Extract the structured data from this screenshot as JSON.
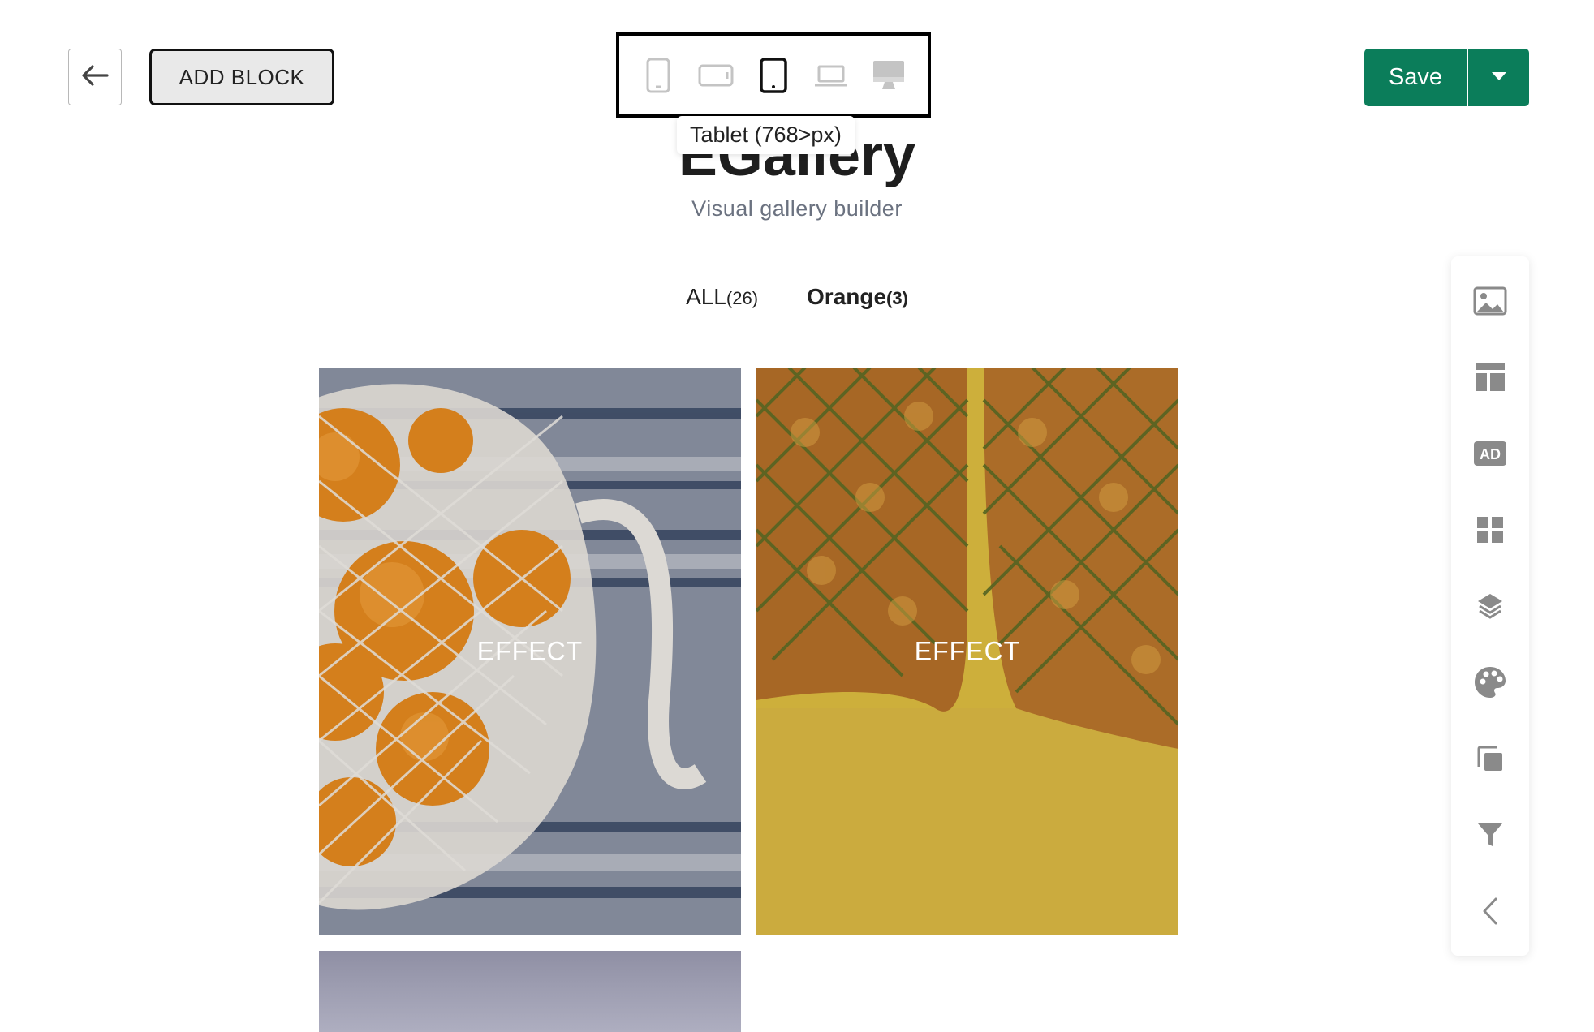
{
  "toolbar": {
    "add_block_label": "ADD BLOCK",
    "save_label": "Save",
    "devices": [
      {
        "name": "mobile",
        "icon": "phone-portrait-icon",
        "active": false
      },
      {
        "name": "mobile-landscape",
        "icon": "phone-landscape-icon",
        "active": false
      },
      {
        "name": "tablet",
        "icon": "tablet-icon",
        "active": true
      },
      {
        "name": "laptop",
        "icon": "laptop-icon",
        "active": false
      },
      {
        "name": "desktop",
        "icon": "desktop-icon",
        "active": false
      }
    ],
    "tooltip": "Tablet (768>px)"
  },
  "header": {
    "title": "EGallery",
    "subtitle": "Visual gallery builder"
  },
  "filters": [
    {
      "label": "ALL",
      "count": "(26)",
      "active": false
    },
    {
      "label": "Orange",
      "count": "(3)",
      "active": true
    }
  ],
  "gallery": {
    "items": [
      {
        "label": "EFFECT",
        "image": "oranges-in-mesh-bag"
      },
      {
        "label": "EFFECT",
        "image": "pineapples-on-yellow"
      },
      {
        "label": "",
        "image": "gray-partial-image"
      }
    ]
  },
  "side_toolbar": {
    "tools": [
      "image-icon",
      "layout-icon",
      "ad-icon",
      "grid-icon",
      "layers-icon",
      "palette-icon",
      "copy-icon",
      "filter-icon",
      "collapse-icon"
    ]
  },
  "colors": {
    "save_green": "#0b7d5a",
    "icon_gray": "#8a8a8a",
    "subtitle_gray": "#6b7280"
  }
}
